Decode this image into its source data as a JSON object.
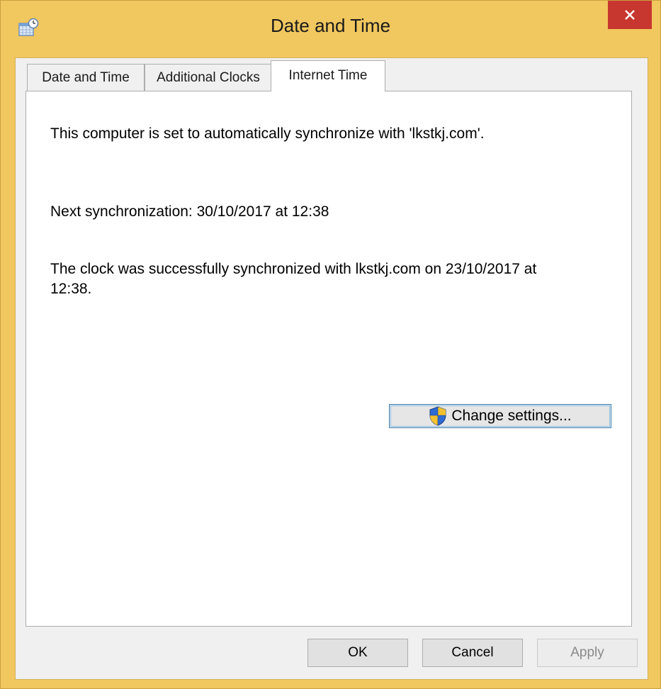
{
  "window": {
    "title": "Date and Time",
    "icon": "calendar-clock-icon",
    "close_icon": "close-icon",
    "accent_color": "#f1c75f",
    "close_color": "#c7372f"
  },
  "tabs": [
    {
      "label": "Date and Time",
      "active": false
    },
    {
      "label": "Additional Clocks",
      "active": false
    },
    {
      "label": "Internet Time",
      "active": true
    }
  ],
  "internet_time": {
    "sync_status": "This computer is set to automatically synchronize with 'lkstkj.com'.",
    "next_sync": "Next synchronization: 30/10/2017 at 12:38",
    "last_sync_line1": "The clock was successfully synchronized with lkstkj.com on 23/10/2017 at",
    "last_sync_line2": "12:38.",
    "change_settings_label": "Change settings...",
    "change_settings_icon": "uac-shield-icon"
  },
  "buttons": {
    "ok_label": "OK",
    "cancel_label": "Cancel",
    "apply_label": "Apply",
    "apply_enabled": false
  }
}
